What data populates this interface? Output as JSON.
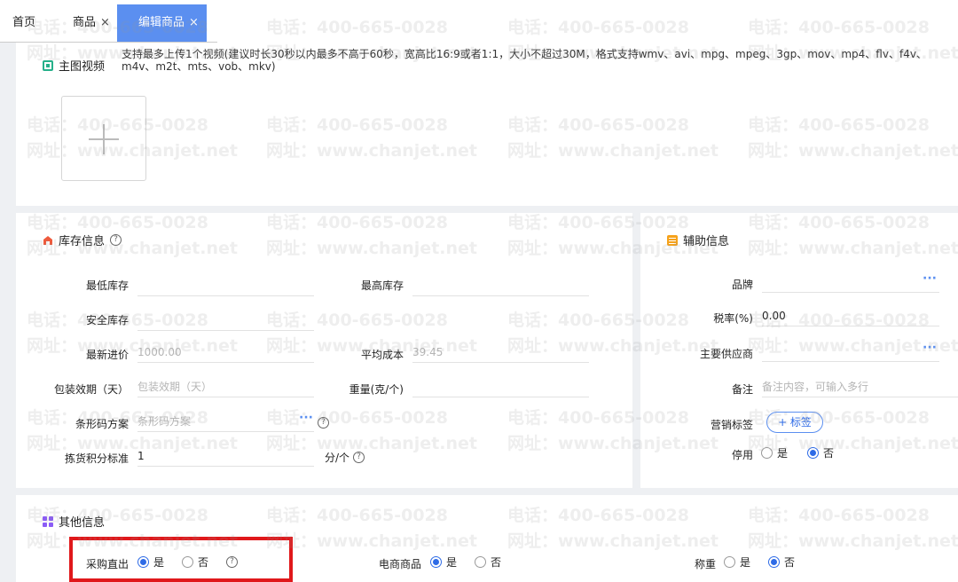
{
  "tabs": {
    "home": "首页",
    "goods": "商品",
    "edit": "编辑商品",
    "close": "×"
  },
  "video": {
    "title": "主图视频",
    "hint": "支持最多上传1个视频(建议时长30秒以内最多不高于60秒，宽高比16:9或者1:1，大小不超过30M，格式支持wmv、avi、mpg、mpeg、3gp、mov、mp4、flv、f4v、m4v、m2t、mts、vob、mkv)"
  },
  "stock": {
    "title": "库存信息",
    "min_stock": "最低库存",
    "max_stock": "最高库存",
    "safe_stock": "安全库存",
    "latest_price_label": "最新进价",
    "latest_price_value": "1000.00",
    "avg_cost_label": "平均成本",
    "avg_cost_value": "39.45",
    "shelf_life_label": "包装效期（天）",
    "shelf_life_placeholder": "包装效期（天）",
    "weight_label": "重量(克/个)",
    "barcode_label": "条形码方案",
    "barcode_placeholder": "条形码方案",
    "picking_label": "拣货积分标准",
    "picking_value": "1",
    "picking_unit": "分/个"
  },
  "aux": {
    "title": "辅助信息",
    "brand_label": "品牌",
    "tax_label": "税率(%)",
    "tax_value": "0.00",
    "supplier_label": "主要供应商",
    "remark_label": "备注",
    "remark_placeholder": "备注内容，可输入多行",
    "marketing_label": "营销标签",
    "add_tag": "+ 标签",
    "disabled_label": "停用",
    "yes": "是",
    "no": "否"
  },
  "other": {
    "title": "其他信息",
    "direct_purchase_label": "采购直出",
    "ecommerce_label": "电商商品",
    "weighing_label": "称重",
    "yes": "是",
    "no": "否"
  },
  "watermark": {
    "phone": "电话：400-665-0028",
    "site": "网址：www.chanjet.net"
  },
  "colors": {
    "accent": "#2e6be6",
    "active_tab": "#5b8ff0",
    "highlight_box": "#e0181b"
  }
}
